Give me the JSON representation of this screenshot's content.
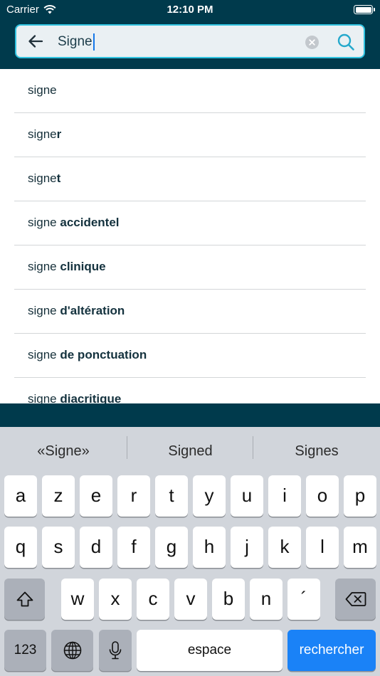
{
  "status": {
    "carrier": "Carrier",
    "time": "12:10 PM"
  },
  "search": {
    "value": "Signe"
  },
  "results": [
    {
      "prefix": "signe",
      "suffix": ""
    },
    {
      "prefix": "signe",
      "suffix": "r"
    },
    {
      "prefix": "signe",
      "suffix": "t"
    },
    {
      "prefix": "signe ",
      "suffix": "accidentel"
    },
    {
      "prefix": "signe ",
      "suffix": "clinique"
    },
    {
      "prefix": "signe ",
      "suffix": "d'altération"
    },
    {
      "prefix": "signe ",
      "suffix": "de ponctuation"
    },
    {
      "prefix": "signe ",
      "suffix": "diacritique"
    }
  ],
  "keyboard": {
    "suggestions": [
      "«Signe»",
      "Signed",
      "Signes"
    ],
    "row1": [
      "a",
      "z",
      "e",
      "r",
      "t",
      "y",
      "u",
      "i",
      "o",
      "p"
    ],
    "row2": [
      "q",
      "s",
      "d",
      "f",
      "g",
      "h",
      "j",
      "k",
      "l",
      "m"
    ],
    "row3": [
      "w",
      "x",
      "c",
      "v",
      "b",
      "n",
      "´"
    ],
    "numbers_label": "123",
    "space_label": "espace",
    "return_label": "rechercher"
  },
  "colors": {
    "header": "#003a4c",
    "accent": "#31c3e0",
    "return_key": "#1a82f7"
  }
}
